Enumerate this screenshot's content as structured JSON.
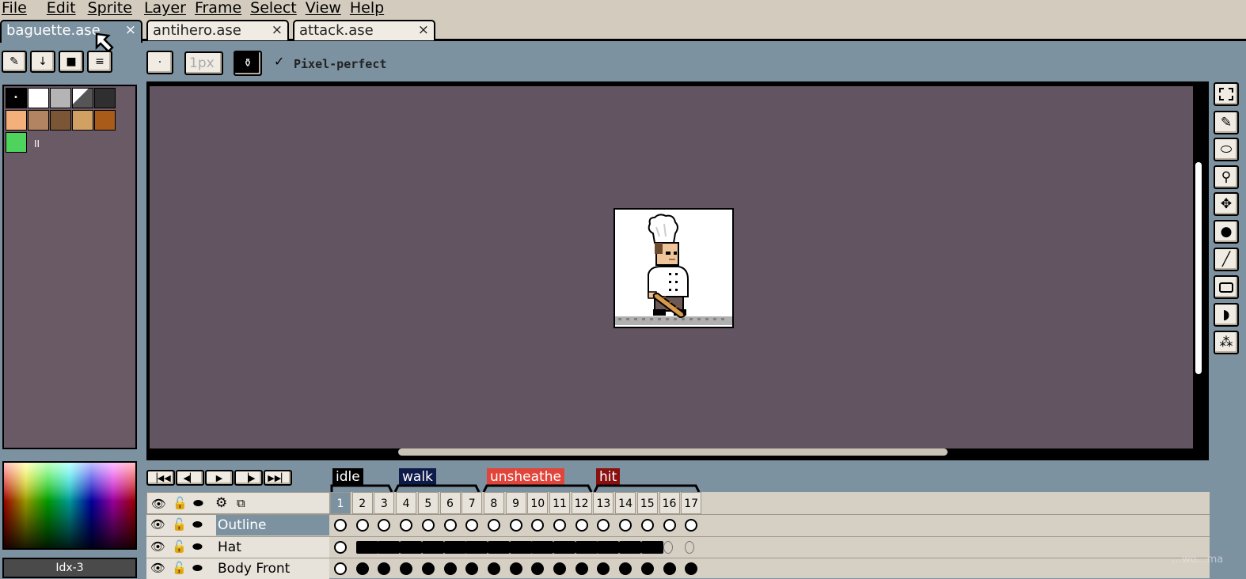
{
  "menu": [
    "File",
    "Edit",
    "Sprite",
    "Layer",
    "Frame",
    "Select",
    "View",
    "Help"
  ],
  "tabs": [
    {
      "label": "baguette.ase",
      "close": "×"
    },
    {
      "label": "antihero.ase",
      "close": "×"
    },
    {
      "label": "attack.ase",
      "close": "×"
    }
  ],
  "toolbar": {
    "brush_size_placeholder": "1px",
    "pixel_perfect_label": "Pixel-perfect",
    "pixel_perfect_check": "✓"
  },
  "palette": {
    "colors": [
      "#000000",
      "#ffffff",
      "#b4b4b4",
      "#555555",
      "#2f2f2f",
      "#f3b07a",
      "#b38462",
      "#7a5637",
      "#d1a164",
      "#a95b1a",
      "#4ed45c"
    ],
    "extra_label": "II"
  },
  "color_index_label": "Idx-3",
  "tags": [
    {
      "label": "idle",
      "color": "#000000"
    },
    {
      "label": "walk",
      "color": "#0d1a4a"
    },
    {
      "label": "unsheathe",
      "color": "#e0443a"
    },
    {
      "label": "hit",
      "color": "#8a1010"
    }
  ],
  "frames": [
    "1",
    "2",
    "3",
    "4",
    "5",
    "6",
    "7",
    "8",
    "9",
    "10",
    "11",
    "12",
    "13",
    "14",
    "15",
    "16",
    "17"
  ],
  "layers": [
    {
      "name": "Outline"
    },
    {
      "name": "Hat"
    },
    {
      "name": "Body Front"
    }
  ],
  "watermark": "…wo…ma"
}
